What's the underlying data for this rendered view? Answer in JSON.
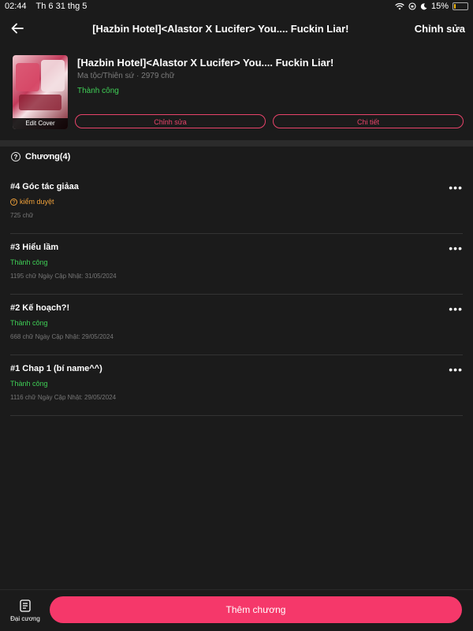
{
  "status_bar": {
    "time": "02:44",
    "date": "Th 6 31 thg 5",
    "battery": "15%",
    "battery_level": 0.15
  },
  "nav": {
    "title": "[Hazbin Hotel]<Alastor X Lucifer> You.... Fuckin Liar!",
    "action_label": "Chỉnh sửa"
  },
  "story": {
    "title": "[Hazbin Hotel]<Alastor X Lucifer> You.... Fuckin Liar!",
    "meta": "Ma tộc/Thiên sứ · 2979 chữ",
    "status": "Thành công",
    "edit_cover_label": "Edit Cover",
    "edit_button": "Chỉnh sửa",
    "detail_button": "Chi tiết"
  },
  "chapters_header": {
    "icon_glyph": "?",
    "label": "Chương(4)"
  },
  "chapters": [
    {
      "title": "#4 Góc tác giảaa",
      "status": "kiểm duyệt",
      "status_type": "review",
      "info": "725 chữ"
    },
    {
      "title": "#3 Hiểu lầm",
      "status": "Thành công",
      "status_type": "ok",
      "info": "1195 chữ Ngày Cập Nhật: 31/05/2024"
    },
    {
      "title": "#2 Kế hoạch?!",
      "status": "Thành công",
      "status_type": "ok",
      "info": "668 chữ Ngày Cập Nhật: 29/05/2024"
    },
    {
      "title": "#1 Chap 1 (bí name^^)",
      "status": "Thành công",
      "status_type": "ok",
      "info": "1116 chữ Ngày Cập Nhật: 29/05/2024"
    }
  ],
  "more_glyph": "•••",
  "bottom": {
    "outline_label": "Đại cương",
    "add_chapter_label": "Thêm chương"
  },
  "colors": {
    "accent": "#f5386a",
    "success": "#3fcf56",
    "review": "#f0a13a",
    "background": "#1b1b1b"
  }
}
